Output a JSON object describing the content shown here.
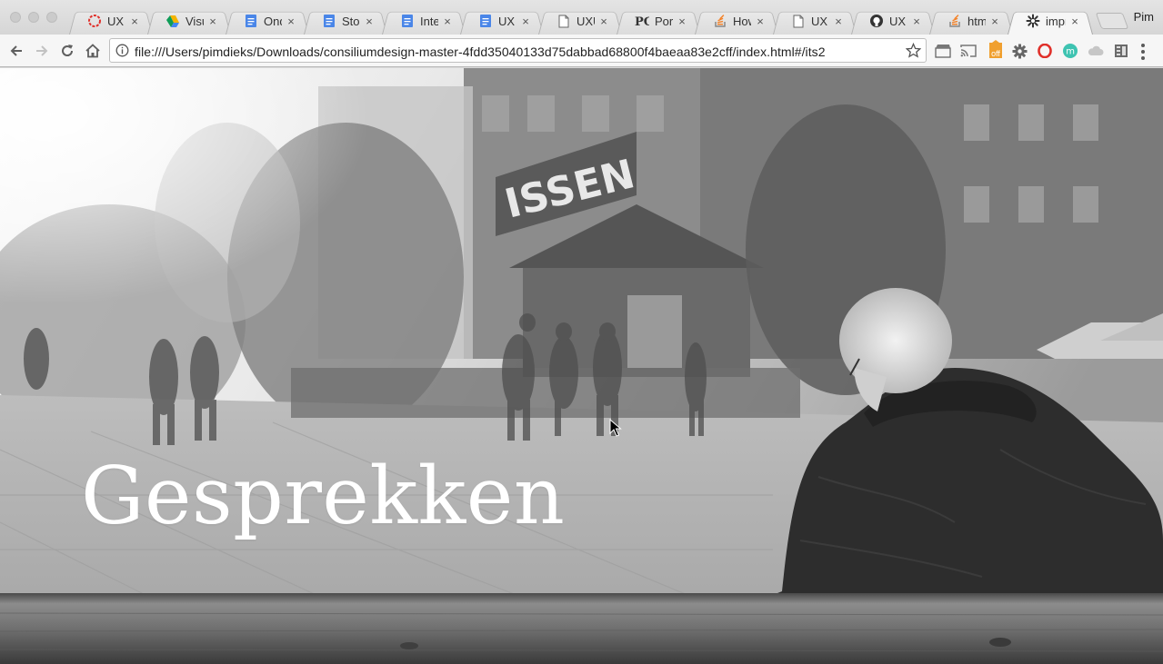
{
  "browser": {
    "tabs": [
      {
        "title": "UX - c",
        "icon": "opera-red-ring-icon",
        "active": false
      },
      {
        "title": "Visua",
        "icon": "google-drive-icon",
        "active": false
      },
      {
        "title": "Onde",
        "icon": "google-docs-icon",
        "active": false
      },
      {
        "title": "Story",
        "icon": "google-docs-icon",
        "active": false
      },
      {
        "title": "Interv",
        "icon": "google-docs-icon",
        "active": false
      },
      {
        "title": "UX - (",
        "icon": "google-docs-icon",
        "active": false
      },
      {
        "title": "UXU",
        "icon": "blank-page-icon",
        "active": false
      },
      {
        "title": "Portfo",
        "icon": "pg-logo-icon",
        "active": false
      },
      {
        "title": "How t",
        "icon": "stackoverflow-icon",
        "active": false
      },
      {
        "title": "UX",
        "icon": "blank-page-icon",
        "active": false
      },
      {
        "title": "UX",
        "icon": "github-icon",
        "active": false
      },
      {
        "title": "html -",
        "icon": "stackoverflow-icon",
        "active": false
      },
      {
        "title": "impre",
        "icon": "impress-star-icon",
        "active": true
      }
    ],
    "close_glyph": "×",
    "profile_name": "Pim",
    "address_url": "file:///Users/pimdieks/Downloads/consiliumdesign-master-4fdd35040133d75dabbad68800f4baeaa83e2cff/index.html#/its2",
    "extension_badge": "off"
  },
  "slide": {
    "title": "Gesprekken"
  },
  "colors": {
    "docs_blue": "#4a86e8",
    "stackoverflow_orange": "#f48024",
    "opera_red": "#e0302a",
    "hero_text": "#ffffff"
  }
}
